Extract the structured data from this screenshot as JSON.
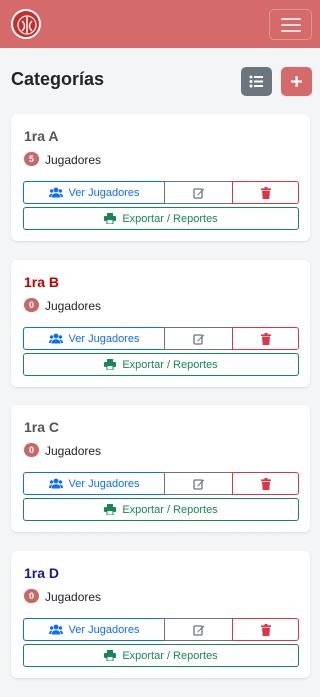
{
  "header": {
    "logo_icon": "team-logo-icon",
    "menu_icon": "hamburger-menu-icon",
    "brand_color": "#d46a6a"
  },
  "page": {
    "title": "Categorías",
    "list_view_icon": "list-icon",
    "add_icon": "plus-icon"
  },
  "actions": {
    "view_players": "Ver Jugadores",
    "export": "Exportar / Reportes",
    "view_icon": "users-icon",
    "edit_icon": "edit-icon",
    "delete_icon": "trash-icon",
    "export_icon": "printer-icon"
  },
  "categories": [
    {
      "name": "1ra A",
      "count": "5",
      "players_label": "Jugadores",
      "color": "#555555"
    },
    {
      "name": "1ra B",
      "count": "0",
      "players_label": "Jugadores",
      "color": "#c00000"
    },
    {
      "name": "1ra C",
      "count": "0",
      "players_label": "Jugadores",
      "color": "#555555"
    },
    {
      "name": "1ra D",
      "count": "0",
      "players_label": "Jugadores",
      "color": "#1a1a8c"
    }
  ]
}
